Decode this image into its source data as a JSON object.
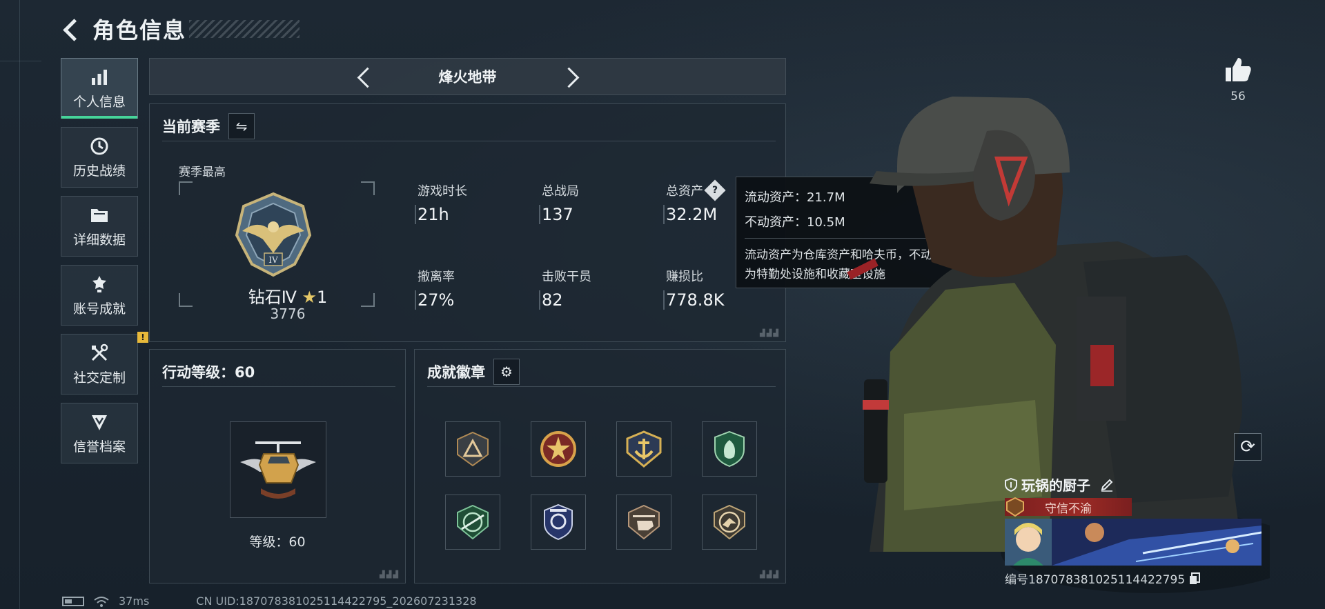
{
  "header": {
    "title": "角色信息"
  },
  "nav": {
    "items": [
      {
        "label": "个人信息",
        "icon": "bar-chart-icon"
      },
      {
        "label": "历史战绩",
        "icon": "history-icon"
      },
      {
        "label": "详细数据",
        "icon": "folder-icon"
      },
      {
        "label": "账号成就",
        "icon": "achievement-icon"
      },
      {
        "label": "社交定制",
        "icon": "tools-icon",
        "badge": "!"
      },
      {
        "label": "信誉档案",
        "icon": "reputation-icon"
      }
    ]
  },
  "mode": {
    "title": "烽火地带"
  },
  "season": {
    "title": "当前赛季",
    "best_label": "赛季最高",
    "rank_name": "钻石Ⅳ",
    "rank_stars": "1",
    "rank_score": "3776",
    "stats": [
      {
        "label": "游戏时长",
        "value": "21h"
      },
      {
        "label": "总战局",
        "value": "137"
      },
      {
        "label": "总资产",
        "value": "32.2M"
      },
      {
        "label": "撤离率",
        "value": "27%"
      },
      {
        "label": "击败干员",
        "value": "82"
      },
      {
        "label": "赚损比",
        "value": "778.8K"
      }
    ]
  },
  "tooltip": {
    "liquid": "流动资产：21.7M",
    "fixed": "不动资产：10.5M",
    "desc_line1": "流动资产为仓库资产和哈夫币，不动资产",
    "desc_line2": "为特勤处设施和收藏室设施"
  },
  "level": {
    "title": "行动等级：60",
    "label": "等级：60"
  },
  "badges": {
    "title": "成就徽章",
    "items": [
      "triangle-badge",
      "star-badge",
      "anchor-badge",
      "shield-badge",
      "rifle-badge",
      "police-badge",
      "helicopter-badge",
      "bird-badge"
    ]
  },
  "player": {
    "likes": "56",
    "name": "玩锅的厨子",
    "title": "守信不渝",
    "id": "编号1870783810251144227​95"
  },
  "footer": {
    "ping": "37ms",
    "uid": "CN UID:1870783810251144227​95_202607231328"
  }
}
